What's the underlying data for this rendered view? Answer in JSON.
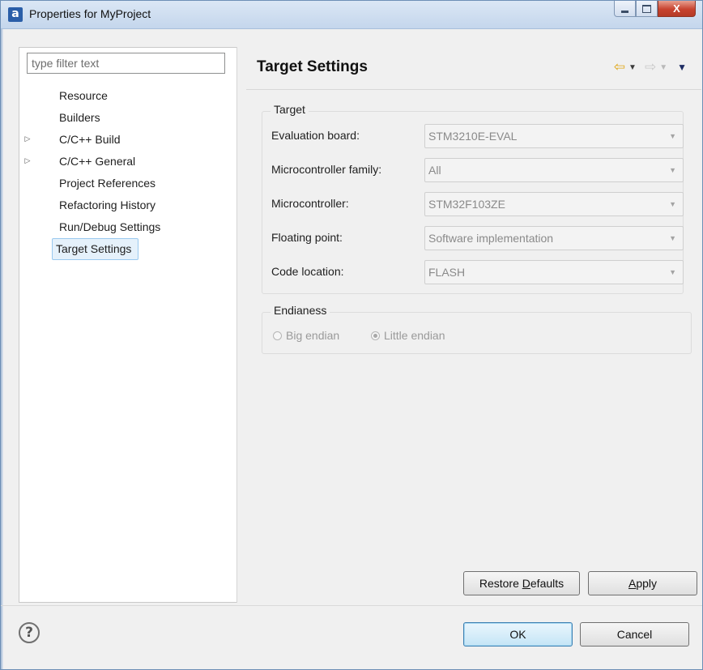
{
  "window": {
    "title": "Properties for MyProject",
    "app_icon_glyph": "a",
    "caption": {
      "minimize_icon": "minimize-icon",
      "maximize_icon": "maximize-icon",
      "close_glyph": "X"
    }
  },
  "filter": {
    "placeholder": "type filter text",
    "value": ""
  },
  "nav": {
    "items": [
      {
        "label": "Resource",
        "expandable": false
      },
      {
        "label": "Builders",
        "expandable": false
      },
      {
        "label": "C/C++ Build",
        "expandable": true
      },
      {
        "label": "C/C++ General",
        "expandable": true
      },
      {
        "label": "Project References",
        "expandable": false
      },
      {
        "label": "Refactoring History",
        "expandable": false
      },
      {
        "label": "Run/Debug Settings",
        "expandable": false
      },
      {
        "label": "Target Settings",
        "expandable": false,
        "selected": true
      }
    ]
  },
  "page": {
    "title": "Target Settings",
    "history": {
      "back_glyph": "⇦",
      "forward_glyph": "⇨",
      "dropdown_glyph": "▼"
    }
  },
  "target": {
    "group_title": "Target",
    "fields": [
      {
        "label": "Evaluation board:",
        "value": "STM3210E-EVAL"
      },
      {
        "label": "Microcontroller family:",
        "value": "All"
      },
      {
        "label": "Microcontroller:",
        "value": "STM32F103ZE"
      },
      {
        "label": "Floating point:",
        "value": "Software implementation"
      },
      {
        "label": "Code location:",
        "value": "FLASH"
      }
    ]
  },
  "endianess": {
    "group_title": "Endianess",
    "options": [
      {
        "label": "Big endian",
        "checked": false
      },
      {
        "label": "Little endian",
        "checked": true
      }
    ]
  },
  "buttons": {
    "restore_defaults": {
      "before": "Restore ",
      "mnemonic": "D",
      "after": "efaults"
    },
    "apply": {
      "before": "",
      "mnemonic": "A",
      "after": "pply"
    },
    "ok": "OK",
    "cancel": "Cancel",
    "help_glyph": "?"
  }
}
